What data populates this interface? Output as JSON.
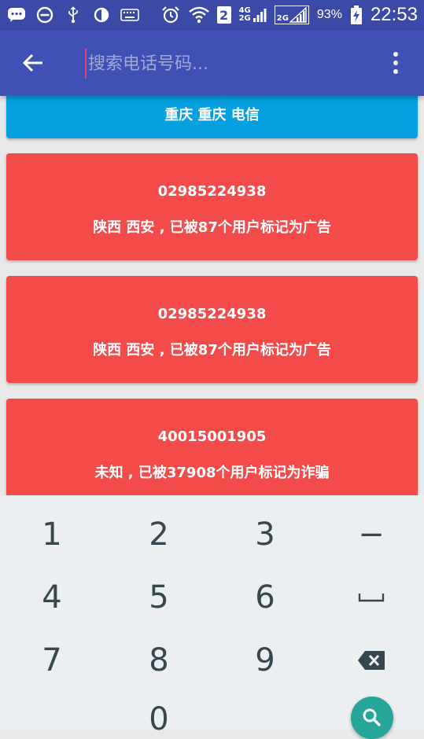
{
  "status_bar": {
    "icons": [
      "chat-bubble-icon",
      "do-not-disturb-icon",
      "usb-icon",
      "data-saver-icon",
      "keyboard-icon",
      "alarm-icon",
      "wifi-icon",
      "sim-2-icon",
      "signal-4g-2g-icon",
      "signal-2g-icon",
      "battery-charging-icon"
    ],
    "sim_number": "2",
    "signal_tag_top": "4G",
    "signal_tag_bottom": "2G",
    "signal2_tag": "2G",
    "battery": "93%",
    "time": "22:53"
  },
  "app_bar": {
    "search_placeholder": "搜索电话号码..."
  },
  "cards": [
    {
      "color": "#05a0e0",
      "line1": "重庆 重庆 电信"
    },
    {
      "color": "#f34a4a",
      "line1": "02985224938",
      "line2": "陕西 西安 , 已被87个用户标记为广告"
    },
    {
      "color": "#f34a4a",
      "line1": "02985224938",
      "line2": "陕西 西安 , 已被87个用户标记为广告"
    },
    {
      "color": "#f34a4a",
      "line1": "40015001905",
      "line2": "未知 , 已被37908个用户标记为诈骗"
    }
  ],
  "keypad": {
    "k1": "1",
    "k2": "2",
    "k3": "3",
    "dash": "−",
    "k4": "4",
    "k5": "5",
    "k6": "6",
    "k7": "7",
    "k8": "8",
    "k9": "9",
    "k0": "0"
  },
  "colors": {
    "primary": "#3f51b5",
    "status_bar": "#3b4aa6",
    "info": "#05a0e0",
    "spam": "#f34a4a",
    "fab": "#26a69a"
  }
}
